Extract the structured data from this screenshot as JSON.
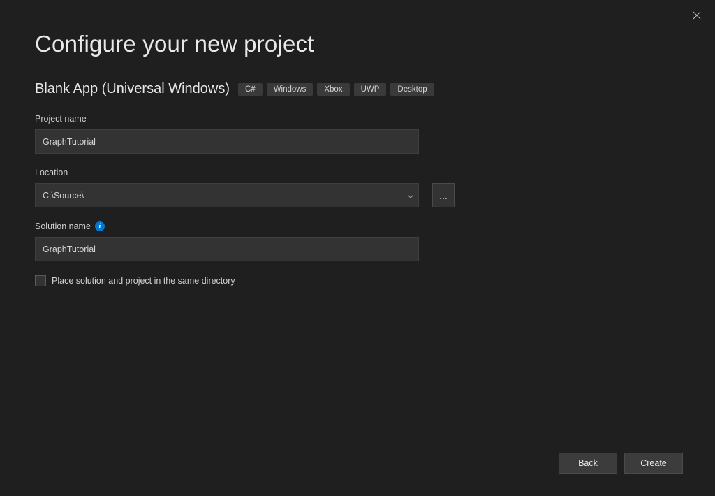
{
  "header": {
    "title": "Configure your new project"
  },
  "template": {
    "name": "Blank App (Universal Windows)",
    "tags": [
      "C#",
      "Windows",
      "Xbox",
      "UWP",
      "Desktop"
    ]
  },
  "form": {
    "project_name_label": "Project name",
    "project_name_value": "GraphTutorial",
    "location_label": "Location",
    "location_value": "C:\\Source\\",
    "browse_label": "...",
    "solution_name_label": "Solution name",
    "solution_name_value": "GraphTutorial",
    "same_directory_label": "Place solution and project in the same directory",
    "same_directory_checked": false
  },
  "footer": {
    "back_label": "Back",
    "create_label": "Create"
  }
}
